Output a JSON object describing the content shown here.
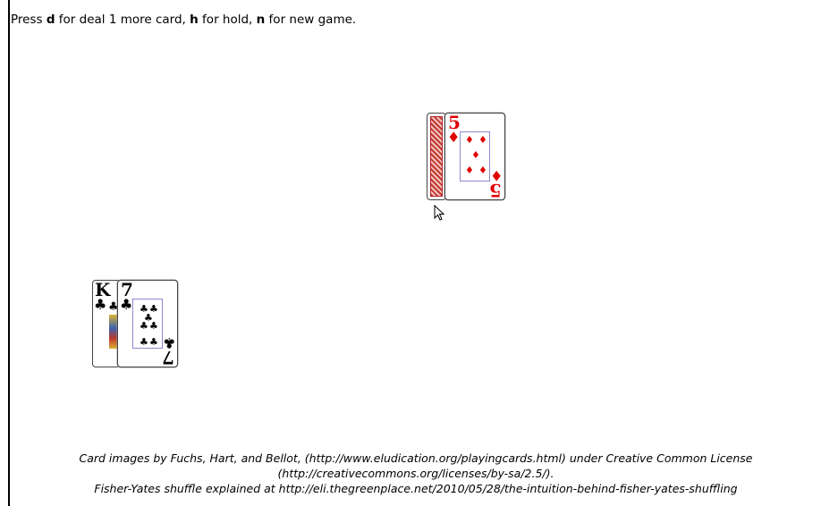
{
  "instructions": {
    "prefix": "Press ",
    "key_deal": "d",
    "text_deal": " for deal 1 more card, ",
    "key_hold": "h",
    "text_hold": " for hold, ",
    "key_new": "n",
    "text_new": " for new game."
  },
  "dealer_hand": {
    "cards": [
      {
        "face": "down"
      },
      {
        "rank": "5",
        "suit": "♦",
        "color": "#e00000"
      }
    ]
  },
  "player_hand": {
    "cards": [
      {
        "rank": "K",
        "suit": "♣",
        "color": "#000000"
      },
      {
        "rank": "7",
        "suit": "♣",
        "color": "#000000"
      }
    ]
  },
  "credits": {
    "line1": "Card images by Fuchs, Hart, and Bellot, (http://www.eludication.org/playingcards.html) under Creative Common License",
    "line2": "(http://creativecommons.org/licenses/by-sa/2.5/).",
    "line3": "Fisher-Yates shuffle explained at http://eli.thegreenplace.net/2010/05/28/the-intuition-behind-fisher-yates-shuffling"
  },
  "icons": {
    "cursor": "mouse-pointer-icon"
  }
}
